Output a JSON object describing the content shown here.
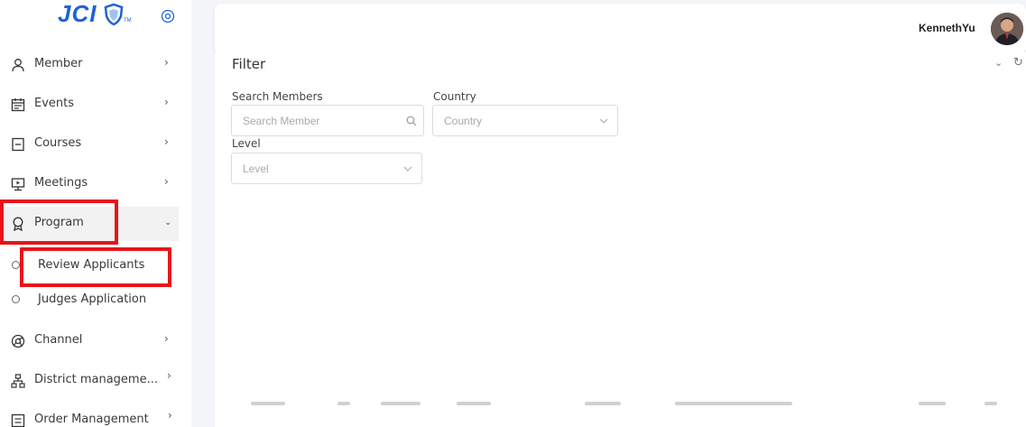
{
  "brand": {
    "logo_text": "JCI",
    "tm": "TM"
  },
  "sidebar": {
    "items": [
      {
        "label": "Member",
        "icon": "user-icon"
      },
      {
        "label": "Events",
        "icon": "calendar-icon"
      },
      {
        "label": "Courses",
        "icon": "book-icon"
      },
      {
        "label": "Meetings",
        "icon": "presentation-icon"
      },
      {
        "label": "Program",
        "icon": "award-icon"
      },
      {
        "label": "Channel",
        "icon": "chrome-icon"
      },
      {
        "label": "District manageme...",
        "icon": "sitemap-icon"
      },
      {
        "label": "Order Management",
        "icon": "list-icon"
      }
    ],
    "sub_items": [
      {
        "label": "Review Applicants"
      },
      {
        "label": "Judges Application"
      }
    ]
  },
  "header": {
    "username": "KennethYu"
  },
  "filter": {
    "title": "Filter",
    "search_label": "Search Members",
    "search_placeholder": "Search Member",
    "country_label": "Country",
    "country_placeholder": "Country",
    "level_label": "Level",
    "level_placeholder": "Level"
  },
  "colors": {
    "accent": "#1e63d6",
    "highlight": "#e8141b"
  }
}
